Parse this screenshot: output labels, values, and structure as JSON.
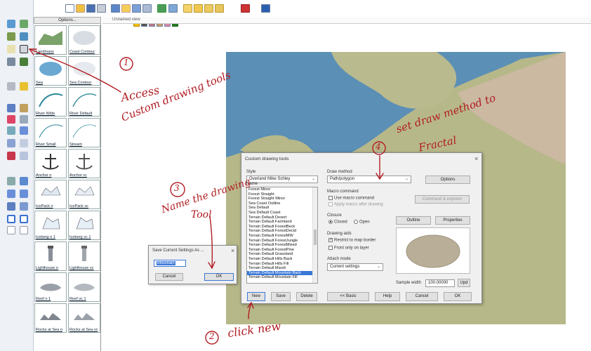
{
  "map_view": {
    "tab_title": "Unnamed view"
  },
  "symbols_panel": {
    "options_label": "Options...",
    "items": [
      {
        "label": "Landmass"
      },
      {
        "label": "Coast Contour"
      },
      {
        "label": "Sea"
      },
      {
        "label": "Sea Contour"
      },
      {
        "label": "River Wide"
      },
      {
        "label": "River Default"
      },
      {
        "label": "River Small"
      },
      {
        "label": "Stream"
      },
      {
        "label": "Anchor n"
      },
      {
        "label": "Anchor vc"
      },
      {
        "label": "IcePack n"
      },
      {
        "label": "IcePack vc"
      },
      {
        "label": "Iceberg n 1"
      },
      {
        "label": "Iceberg vc 1"
      },
      {
        "label": "Lighthouse n"
      },
      {
        "label": "Lighthouse vc"
      },
      {
        "label": "Reef n 1"
      },
      {
        "label": "Reef vc 1"
      },
      {
        "label": "Rocks at Sea n"
      },
      {
        "label": "Rocks at Sea vc"
      }
    ]
  },
  "dialog": {
    "title": "Custom drawing tools",
    "style_label": "Style",
    "style_value": "Overland Mike Schley",
    "name_label": "Name",
    "names": [
      "Forest Minor",
      "Forest Straight",
      "Forest Straight Minor",
      "Sea Coast Outline",
      "Sea Default",
      "Sea Default Coast",
      "Terrain Default Desert",
      "Terrain Default Farmland",
      "Terrain Default ForestBeck",
      "Terrain Default ForestDecid",
      "Terrain Default ForestMW",
      "Terrain Default ForestJungle",
      "Terrain Default ForestMixed",
      "Terrain Default ForestPine",
      "Terrain Default Grassland",
      "Terrain Default Hills Back",
      "Terrain Default Hills Fill",
      "Terrain Default Marsh",
      "Terrain Default Mountain Back",
      "Terrain Default Mountain Fill"
    ],
    "selected_name": "Terrain Default Mountain Back",
    "draw_method_label": "Draw method",
    "draw_method_value": "Path/polygon",
    "options_button": "Options",
    "macro_label": "Macro command",
    "use_macro": "Use macro command",
    "apply_macro": "Apply macro after drawing",
    "command_explorer": "Command & explorer",
    "closure_label": "Closure",
    "closed": "Closed",
    "open": "Open",
    "outline_button": "Outline",
    "properties_button": "Properties",
    "drawing_aids_label": "Drawing aids",
    "restrict": "Restrict to map border",
    "front_only": "Front only on layer",
    "attach_label": "Attach mode",
    "attach_value": "Current settings",
    "sample_width_label": "Sample width",
    "sample_width_value": "100.00000",
    "upd_button": "Upd",
    "buttons": {
      "new": "New",
      "save": "Save",
      "delete": "Delete",
      "basic": "<< Basic",
      "help": "Help",
      "cancel": "Cancel",
      "ok": "OK"
    }
  },
  "save_dialog": {
    "title": "Save Current Settings As ...",
    "input_value": "Mountain",
    "cancel": "Cancel",
    "ok": "OK"
  },
  "annotations": {
    "step1": "1",
    "step1_line1": "Access",
    "step1_line2": "Custom drawing tools",
    "step2": "2",
    "step2_text": "click new",
    "step3": "3",
    "step3_line1": "Name the drawing",
    "step3_line2": "Tool",
    "step4": "4",
    "step4_line1": "set draw method to",
    "step4_line2": "Fractal"
  },
  "colors": {
    "annotation": "#b11c22",
    "selection": "#3a78d8",
    "sea": "#5b8fb5",
    "land": "#b9ba8e"
  }
}
